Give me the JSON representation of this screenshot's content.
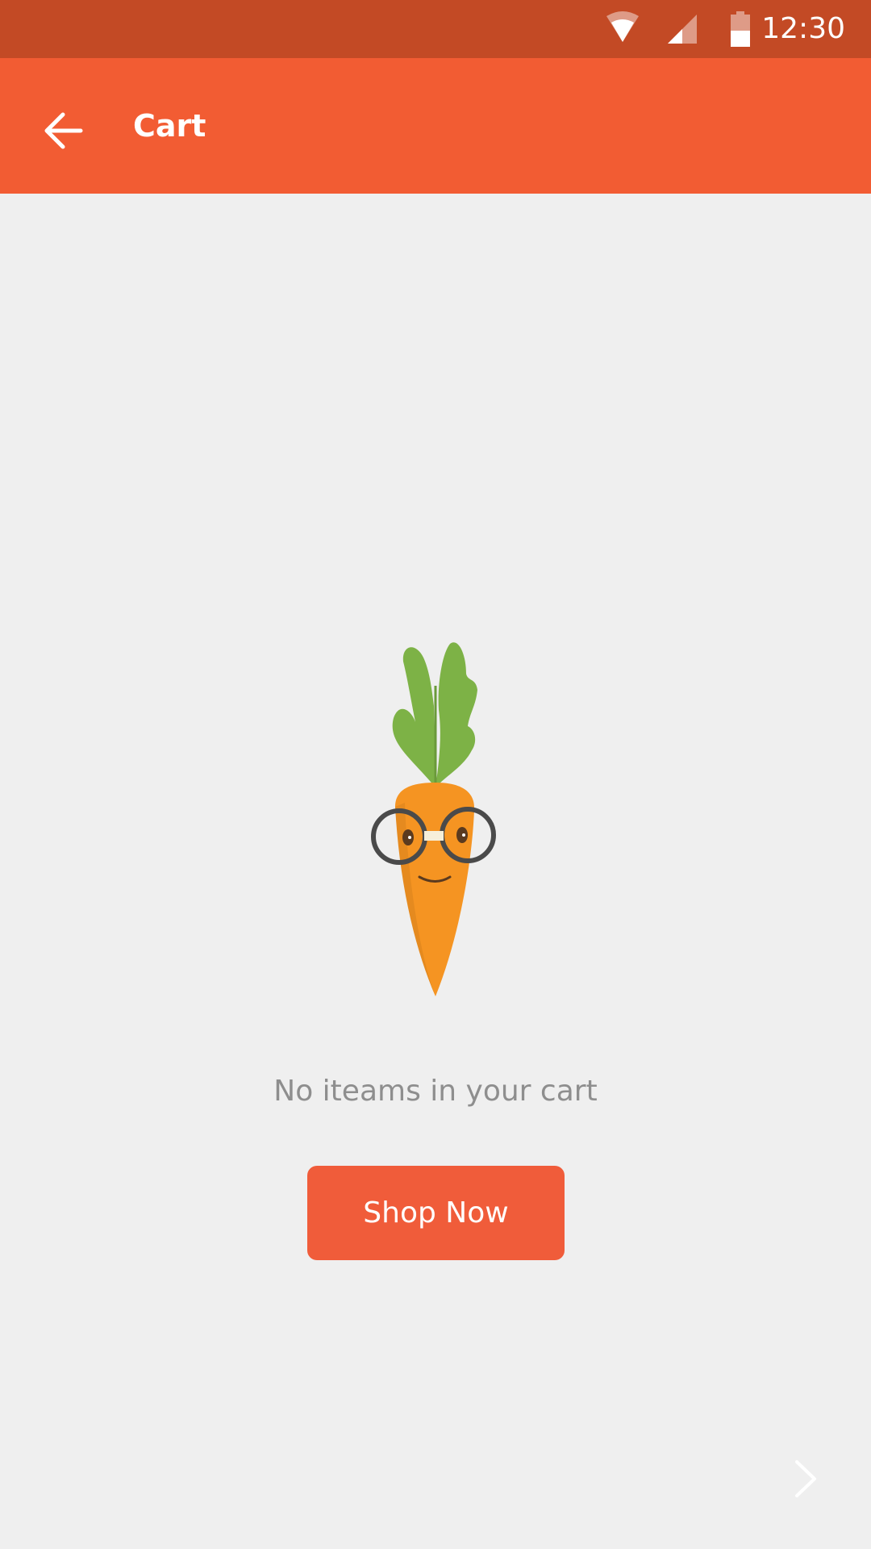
{
  "status_bar": {
    "time": "12:30",
    "icons": [
      "wifi-icon",
      "cell-signal-icon",
      "battery-icon"
    ]
  },
  "app_bar": {
    "back_icon": "arrow-left-icon",
    "title": "Cart"
  },
  "empty_state": {
    "illustration": "carrot-with-glasses",
    "message": "No iteams in your cart",
    "button_label": "Shop Now"
  },
  "footer": {
    "chevron_icon": "chevron-right-icon"
  },
  "colors": {
    "status_bar": "#c34a25",
    "app_bar": "#f25c33",
    "background": "#efefef",
    "button": "#f05c3a",
    "message_text": "#8e8e8e"
  }
}
